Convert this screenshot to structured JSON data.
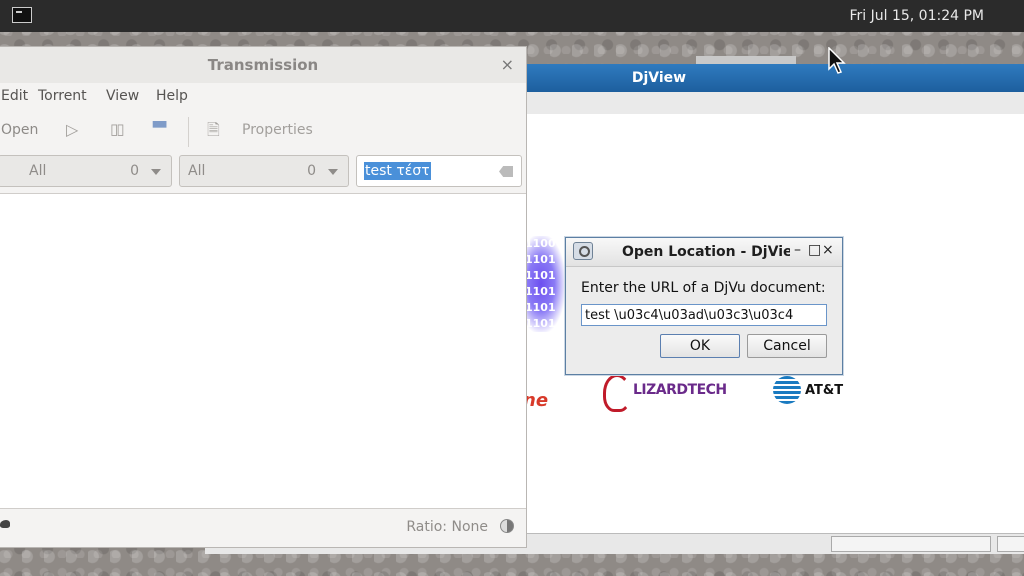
{
  "top_panel": {
    "clock": "Fri Jul 15, 01:24 PM"
  },
  "djview": {
    "title": "DjView",
    "page_logos": {
      "lizardtech": "LIZARDTECH",
      "att": "AT&T",
      "red_partial": "ne",
      "binary": "1100 1101 1101 1101 1101 1101"
    }
  },
  "transmission": {
    "title": "Transmission",
    "menu": [
      "Edit",
      "Torrent",
      "View",
      "Help"
    ],
    "toolbar": {
      "open": "Open",
      "properties": "Properties"
    },
    "filter1": {
      "label": "All",
      "count": "0"
    },
    "filter2": {
      "label": "All",
      "count": "0"
    },
    "search_value": "test τέστ",
    "status": {
      "ratio": "Ratio: None"
    }
  },
  "dialog": {
    "title": "Open Location - DjView",
    "prompt": "Enter the URL of a DjVu document:",
    "url_value": "test \\u03c4\\u03ad\\u03c3\\u03c4",
    "ok_label": "OK",
    "cancel_label": "Cancel"
  }
}
